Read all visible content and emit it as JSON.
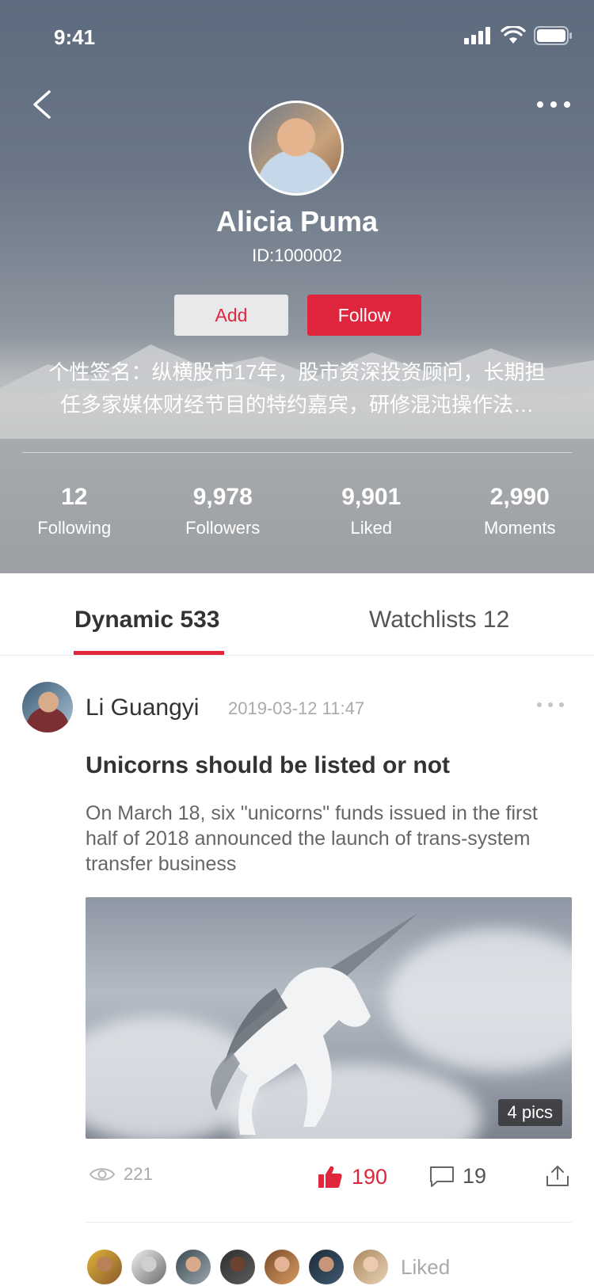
{
  "status_bar": {
    "time": "9:41"
  },
  "profile": {
    "name": "Alicia Puma",
    "id_text": "ID:1000002",
    "add_label": "Add",
    "follow_label": "Follow",
    "bio_line1": "个性签名：纵横股市17年，股市资深投资顾问，长期担",
    "bio_line2": "任多家媒体财经节目的特约嘉宾，研修混沌操作法…"
  },
  "stats": [
    {
      "value": "12",
      "label": "Following"
    },
    {
      "value": "9,978",
      "label": "Followers"
    },
    {
      "value": "9,901",
      "label": "Liked"
    },
    {
      "value": "2,990",
      "label": "Moments"
    }
  ],
  "tabs": [
    {
      "label": "Dynamic 533",
      "active": true
    },
    {
      "label": "Watchlists 12",
      "active": false
    }
  ],
  "post": {
    "author": "Li Guangyi",
    "time": "2019-03-12 11:47",
    "title": "Unicorns should be listed or not",
    "summary": "On March 18, six \"unicorns\" funds issued in the first half of 2018 announced the launch of trans-system transfer business",
    "pics_badge": "4 pics",
    "views": "221",
    "likes": "190",
    "comments": "19",
    "liked_label": "Liked"
  },
  "colors": {
    "accent": "#e0263d",
    "muted_text": "#aaaaaa"
  },
  "icons": [
    "back-icon",
    "more-icon",
    "signal-icon",
    "wifi-icon",
    "battery-icon",
    "eye-icon",
    "thumbs-up-icon",
    "comment-icon",
    "share-icon"
  ]
}
